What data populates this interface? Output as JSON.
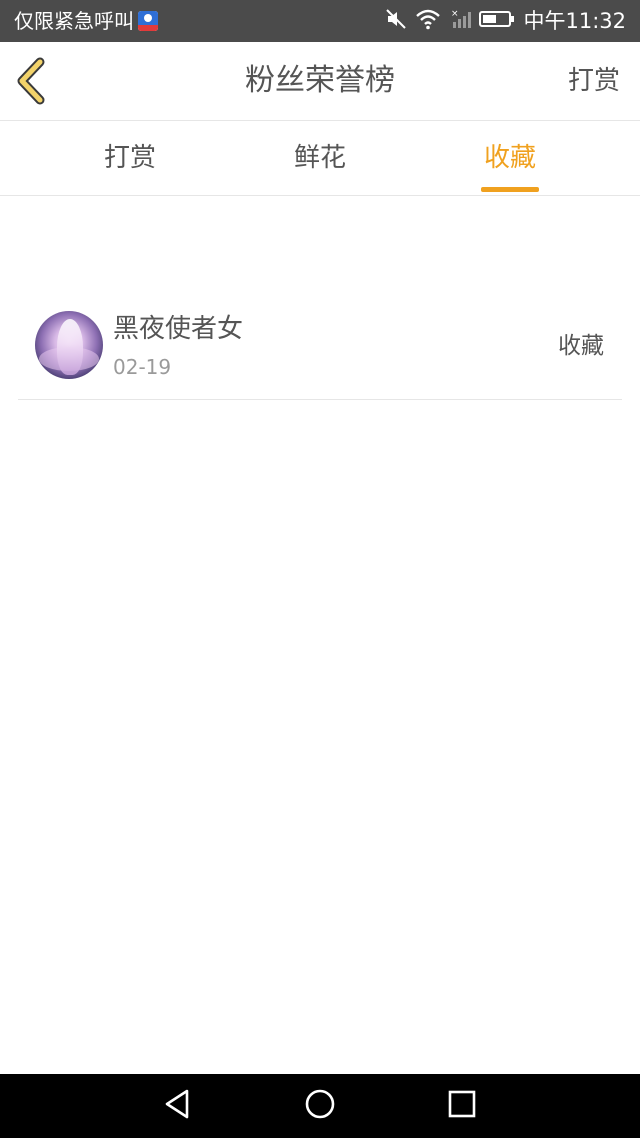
{
  "status_bar": {
    "carrier": "仅限紧急呼叫",
    "time": "中午11:32",
    "icons": [
      "app-badge-icon",
      "mute-icon",
      "wifi-icon",
      "signal-icon",
      "battery-icon"
    ]
  },
  "header": {
    "back_icon": "chevron-left-icon",
    "title": "粉丝荣誉榜",
    "action_label": "打赏"
  },
  "tabs": [
    {
      "label": "打赏",
      "active": false
    },
    {
      "label": "鲜花",
      "active": false
    },
    {
      "label": "收藏",
      "active": true
    }
  ],
  "list": [
    {
      "name": "黑夜使者女",
      "date": "02-19",
      "action": "收藏",
      "avatar_icon": "avatar-image"
    }
  ],
  "nav_bar": {
    "icons": [
      "back-triangle-icon",
      "home-circle-icon",
      "recents-square-icon"
    ]
  },
  "colors": {
    "accent": "#f0a11f",
    "text": "#555555",
    "muted": "#9a9a9a",
    "status_bar": "#4b4b4b",
    "back_icon": "#f3d36a"
  }
}
